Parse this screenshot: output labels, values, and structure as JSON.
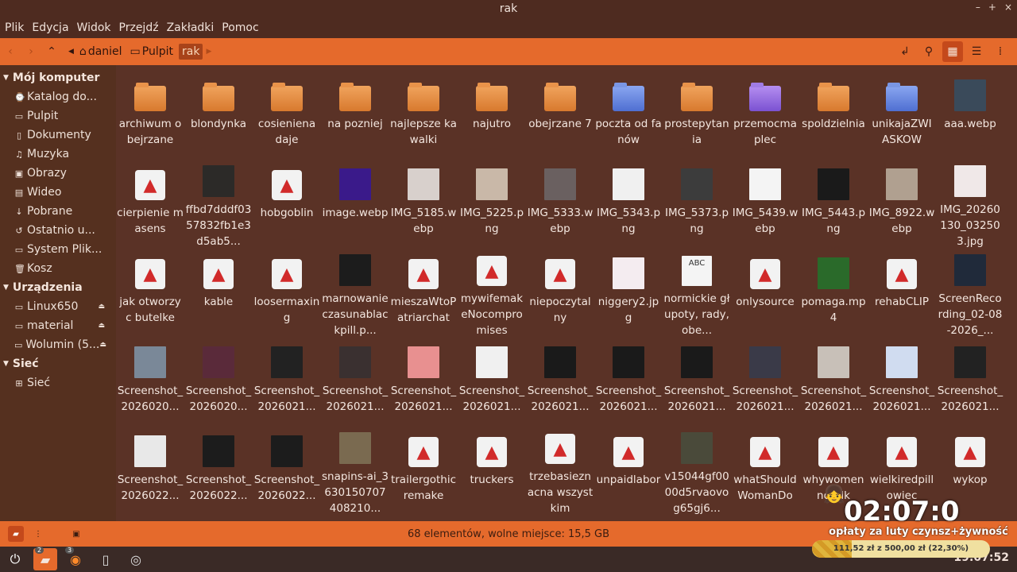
{
  "window": {
    "title": "rak",
    "controls": [
      "–",
      "+",
      "×"
    ]
  },
  "menu": [
    "Plik",
    "Edycja",
    "Widok",
    "Przejdź",
    "Zakładki",
    "Pomoc"
  ],
  "breadcrumbs": [
    {
      "label": "daniel",
      "icon": "home-icon"
    },
    {
      "label": "Pulpit",
      "icon": "folder-icon"
    },
    {
      "label": "rak",
      "icon": "",
      "active": true
    }
  ],
  "sidebar": {
    "sections": [
      {
        "title": "Mój komputer",
        "items": [
          {
            "label": "Katalog do...",
            "icon": "clock-icon",
            "glyph": "⌚"
          },
          {
            "label": "Pulpit",
            "icon": "desktop-icon",
            "glyph": "▭"
          },
          {
            "label": "Dokumenty",
            "icon": "document-icon",
            "glyph": "▯"
          },
          {
            "label": "Muzyka",
            "icon": "music-icon",
            "glyph": "♫"
          },
          {
            "label": "Obrazy",
            "icon": "image-icon",
            "glyph": "▣"
          },
          {
            "label": "Wideo",
            "icon": "video-icon",
            "glyph": "▤"
          },
          {
            "label": "Pobrane",
            "icon": "download-icon",
            "glyph": "↓"
          },
          {
            "label": "Ostatnio u...",
            "icon": "recent-icon",
            "glyph": "↺"
          },
          {
            "label": "System Plik...",
            "icon": "drive-icon",
            "glyph": "▭"
          },
          {
            "label": "Kosz",
            "icon": "trash-icon",
            "glyph": "🗑"
          }
        ]
      },
      {
        "title": "Urządzenia",
        "items": [
          {
            "label": "Linux650",
            "icon": "drive-icon",
            "glyph": "▭",
            "eject": true
          },
          {
            "label": "material",
            "icon": "drive-icon",
            "glyph": "▭",
            "eject": true
          },
          {
            "label": "Wolumin (5...",
            "icon": "drive-icon",
            "glyph": "▭",
            "eject": true
          }
        ]
      },
      {
        "title": "Sieć",
        "items": [
          {
            "label": "Sieć",
            "icon": "network-icon",
            "glyph": "⊞"
          }
        ]
      }
    ]
  },
  "files": [
    {
      "name": "archiwum obejrzane",
      "kind": "folder"
    },
    {
      "name": "blondynka",
      "kind": "folder"
    },
    {
      "name": "cosieniena daje",
      "kind": "folder"
    },
    {
      "name": "na pozniej",
      "kind": "folder"
    },
    {
      "name": "najlepsze kawalki",
      "kind": "folder"
    },
    {
      "name": "najutro",
      "kind": "folder"
    },
    {
      "name": "obejrzane 7",
      "kind": "folder"
    },
    {
      "name": "poczta od fanów",
      "kind": "folder-blue"
    },
    {
      "name": "prostepytania",
      "kind": "folder"
    },
    {
      "name": "przemocmaplec",
      "kind": "folder-purple"
    },
    {
      "name": "spoldzielnia",
      "kind": "folder"
    },
    {
      "name": "unikajaZWIASKOW",
      "kind": "folder-blue"
    },
    {
      "name": "aaa.webp",
      "kind": "thumb",
      "tint": "#3a4a5a"
    },
    {
      "name": "cierpienie masens",
      "kind": "rocket"
    },
    {
      "name": "ffbd7dddf0357832fb1e3d5ab5...",
      "kind": "thumb",
      "tint": "#2c2a28"
    },
    {
      "name": "hobgoblin",
      "kind": "rocket"
    },
    {
      "name": "image.webp",
      "kind": "thumb",
      "tint": "#3a1a8a"
    },
    {
      "name": "IMG_5185.webp",
      "kind": "thumb",
      "tint": "#d8d0cc"
    },
    {
      "name": "IMG_5225.png",
      "kind": "thumb",
      "tint": "#c9b8a8"
    },
    {
      "name": "IMG_5333.webp",
      "kind": "thumb",
      "tint": "#6a6060"
    },
    {
      "name": "IMG_5343.png",
      "kind": "thumb",
      "tint": "#f0f0f0"
    },
    {
      "name": "IMG_5373.png",
      "kind": "thumb",
      "tint": "#3c3c3c"
    },
    {
      "name": "IMG_5439.webp",
      "kind": "thumb",
      "tint": "#f4f4f4"
    },
    {
      "name": "IMG_5443.png",
      "kind": "thumb",
      "tint": "#1a1a1a"
    },
    {
      "name": "IMG_8922.webp",
      "kind": "thumb",
      "tint": "#b0a090"
    },
    {
      "name": "IMG_20260130_032503.jpg",
      "kind": "thumb",
      "tint": "#f0e8e8"
    },
    {
      "name": "jak otworzyc butelke",
      "kind": "rocket"
    },
    {
      "name": "kable",
      "kind": "rocket"
    },
    {
      "name": "loosermaxing",
      "kind": "rocket"
    },
    {
      "name": "marnowanieczasunablackpill.p...",
      "kind": "thumb",
      "tint": "#1c1c1c"
    },
    {
      "name": "mieszaWtoPatriarchat",
      "kind": "rocket"
    },
    {
      "name": "mywifemakeNocompromises",
      "kind": "rocket"
    },
    {
      "name": "niepoczytalny",
      "kind": "rocket"
    },
    {
      "name": "niggery2.jpg",
      "kind": "thumb",
      "tint": "#f4ecf0"
    },
    {
      "name": "normickie głupoty, rady, obe...",
      "kind": "abc"
    },
    {
      "name": "onlysource",
      "kind": "rocket"
    },
    {
      "name": "pomaga.mp4",
      "kind": "thumb",
      "tint": "#2a6a2a"
    },
    {
      "name": "rehabCLIP",
      "kind": "rocket"
    },
    {
      "name": "ScreenRecording_02-08-2026_...",
      "kind": "thumb",
      "tint": "#202a3a"
    },
    {
      "name": "Screenshot_2026020...",
      "kind": "thumb",
      "tint": "#7a8898"
    },
    {
      "name": "Screenshot_2026020...",
      "kind": "thumb",
      "tint": "#5a2a3a"
    },
    {
      "name": "Screenshot_2026021...",
      "kind": "thumb",
      "tint": "#222"
    },
    {
      "name": "Screenshot_2026021...",
      "kind": "thumb",
      "tint": "#3a3030"
    },
    {
      "name": "Screenshot_2026021...",
      "kind": "thumb",
      "tint": "#e89090"
    },
    {
      "name": "Screenshot_2026021...",
      "kind": "thumb",
      "tint": "#f0f0f0"
    },
    {
      "name": "Screenshot_2026021...",
      "kind": "thumb",
      "tint": "#1a1a1a"
    },
    {
      "name": "Screenshot_2026021...",
      "kind": "thumb",
      "tint": "#1a1a1a"
    },
    {
      "name": "Screenshot_2026021...",
      "kind": "thumb",
      "tint": "#1a1a1a"
    },
    {
      "name": "Screenshot_2026021...",
      "kind": "thumb",
      "tint": "#3a3a48"
    },
    {
      "name": "Screenshot_2026021...",
      "kind": "thumb",
      "tint": "#c8c0b8"
    },
    {
      "name": "Screenshot_2026021...",
      "kind": "thumb",
      "tint": "#d0dcf0"
    },
    {
      "name": "Screenshot_2026021...",
      "kind": "thumb",
      "tint": "#222"
    },
    {
      "name": "Screenshot_2026022...",
      "kind": "thumb",
      "tint": "#e8e8e8"
    },
    {
      "name": "Screenshot_2026022...",
      "kind": "thumb",
      "tint": "#1c1c1c"
    },
    {
      "name": "Screenshot_2026022...",
      "kind": "thumb",
      "tint": "#1c1c1c"
    },
    {
      "name": "snapins-ai_3630150707408210...",
      "kind": "thumb",
      "tint": "#7a6a50"
    },
    {
      "name": "trailergothicremake",
      "kind": "rocket"
    },
    {
      "name": "truckers",
      "kind": "rocket"
    },
    {
      "name": "trzebasieznacna wszystkim",
      "kind": "rocket"
    },
    {
      "name": "unpaidlabor",
      "kind": "rocket"
    },
    {
      "name": "v15044gf0000d5rvaovog65gj6...",
      "kind": "thumb",
      "tint": "#4a4a3a"
    },
    {
      "name": "whatShouldWomanDo",
      "kind": "rocket"
    },
    {
      "name": "whywomennotalk",
      "kind": "rocket"
    },
    {
      "name": "wielkiredpillowiec",
      "kind": "rocket"
    },
    {
      "name": "wykop",
      "kind": "rocket"
    }
  ],
  "status": {
    "text": "68 elementów, wolne miejsce: 15,5 GB"
  },
  "taskbar": {
    "clock": "19:07:52",
    "badges": [
      "2",
      "3"
    ]
  },
  "overlay": {
    "timer": "02:07:0",
    "caption": "opłaty za luty czynsz+żywność",
    "progress_text": "111,52 zł z 500,00 zł (22,30%)",
    "progress_fraction": 0.223
  }
}
